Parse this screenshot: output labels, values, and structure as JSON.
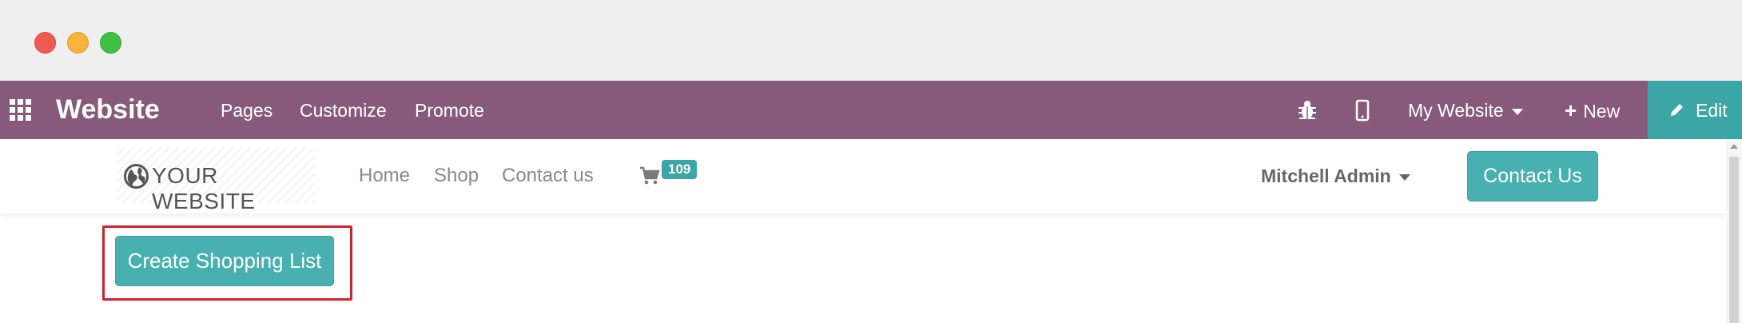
{
  "window": {
    "controls": [
      "close",
      "minimize",
      "maximize"
    ]
  },
  "topbar": {
    "apps_icon": "apps-grid-icon",
    "brand": "Website",
    "menu": [
      "Pages",
      "Customize",
      "Promote"
    ],
    "debug_icon": "bug-icon",
    "mobile_icon": "mobile-icon",
    "website_selector": "My Website",
    "new_label": "New",
    "edit_label": "Edit",
    "colors": {
      "bar": "#875a7b",
      "edit": "#3ca5a5"
    }
  },
  "sitenav": {
    "logo_text": "YOUR WEBSITE",
    "links": [
      "Home",
      "Shop",
      "Contact us"
    ],
    "cart_icon": "cart-icon",
    "cart_count": "109",
    "user": "Mitchell Admin",
    "contact_button": "Contact Us",
    "accent": "#48b0b0"
  },
  "main": {
    "create_button": "Create Shopping List",
    "highlight_color": "#d0232d"
  }
}
